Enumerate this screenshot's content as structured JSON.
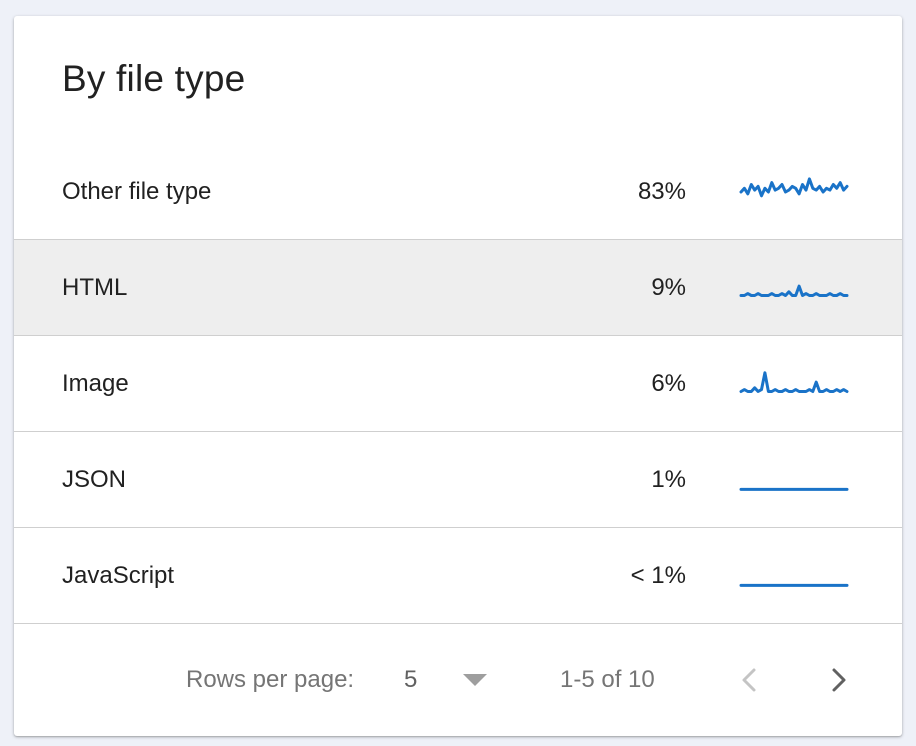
{
  "card": {
    "title": "By file type"
  },
  "rows": [
    {
      "label": "Other file type",
      "percent": "83%",
      "sparkline": [
        8,
        10,
        7,
        12,
        9,
        11,
        6,
        10,
        8,
        13,
        9,
        10,
        12,
        8,
        9,
        11,
        10,
        7,
        12,
        9,
        15,
        10,
        9,
        11,
        8,
        10,
        9,
        12,
        10,
        13,
        9,
        11
      ]
    },
    {
      "label": "HTML",
      "percent": "9%",
      "sparkline": [
        4,
        4,
        5,
        4,
        4,
        5,
        4,
        4,
        4,
        5,
        4,
        4,
        5,
        4,
        6,
        4,
        4,
        9,
        4,
        5,
        4,
        4,
        5,
        4,
        4,
        4,
        5,
        4,
        4,
        5,
        4,
        4
      ]
    },
    {
      "label": "Image",
      "percent": "6%",
      "sparkline": [
        4,
        5,
        4,
        4,
        6,
        4,
        5,
        14,
        4,
        4,
        5,
        4,
        4,
        5,
        4,
        4,
        5,
        4,
        4,
        4,
        5,
        4,
        9,
        4,
        4,
        5,
        4,
        4,
        5,
        4,
        5,
        4
      ]
    },
    {
      "label": "JSON",
      "percent": "1%",
      "sparkline": [
        3,
        3,
        3,
        3,
        3,
        3,
        3,
        3,
        3,
        3,
        3,
        3,
        3,
        3,
        3,
        3,
        3,
        3,
        3,
        3,
        3,
        3,
        3,
        3,
        3,
        3,
        3,
        3,
        3,
        3,
        3,
        3
      ]
    },
    {
      "label": "JavaScript",
      "percent": "< 1%",
      "sparkline": [
        3,
        3,
        3,
        3,
        3,
        3,
        3,
        3,
        3,
        3,
        3,
        3,
        3,
        3,
        3,
        3,
        3,
        3,
        3,
        3,
        3,
        3,
        3,
        3,
        3,
        3,
        3,
        3,
        3,
        3,
        3,
        3
      ]
    }
  ],
  "pagination": {
    "rows_per_page_label": "Rows per page:",
    "rows_per_page_value": "5",
    "range_text": "1-5 of 10",
    "prev_icon": "chevron-left-icon",
    "next_icon": "chevron-right-icon"
  },
  "colors": {
    "sparkline": "#1a73c8",
    "hover_row": "#eeeeee",
    "page_background": "#eef1f8"
  }
}
